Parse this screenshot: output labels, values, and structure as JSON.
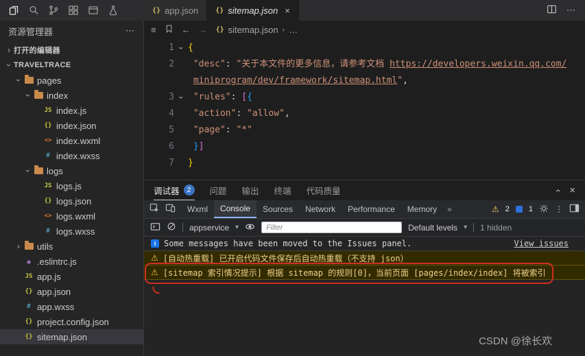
{
  "tabs": {
    "items": [
      {
        "icon": "{}",
        "label": "app.json"
      },
      {
        "icon": "{}",
        "label": "sitemap.json",
        "close": "×"
      }
    ],
    "more": "⋯"
  },
  "sidebar": {
    "title": "资源管理器",
    "more": "⋯",
    "tree": [
      {
        "label": "打开的编辑器",
        "level": 0,
        "chev": "right",
        "icon": "none",
        "section": true
      },
      {
        "label": "TRAVELTRACE",
        "level": 0,
        "chev": "down",
        "icon": "none",
        "section": true
      },
      {
        "label": "pages",
        "level": 1,
        "chev": "down",
        "icon": "folder"
      },
      {
        "label": "index",
        "level": 2,
        "chev": "down",
        "icon": "folder"
      },
      {
        "label": "index.js",
        "level": 3,
        "icon": "js"
      },
      {
        "label": "index.json",
        "level": 3,
        "icon": "json"
      },
      {
        "label": "index.wxml",
        "level": 3,
        "icon": "wxml"
      },
      {
        "label": "index.wxss",
        "level": 3,
        "icon": "wxss"
      },
      {
        "label": "logs",
        "level": 2,
        "chev": "down",
        "icon": "folder"
      },
      {
        "label": "logs.js",
        "level": 3,
        "icon": "js"
      },
      {
        "label": "logs.json",
        "level": 3,
        "icon": "json"
      },
      {
        "label": "logs.wxml",
        "level": 3,
        "icon": "wxml"
      },
      {
        "label": "logs.wxss",
        "level": 3,
        "icon": "wxss"
      },
      {
        "label": "utils",
        "level": 1,
        "chev": "right",
        "icon": "folder"
      },
      {
        "label": ".eslintrc.js",
        "level": 1,
        "icon": "eslint"
      },
      {
        "label": "app.js",
        "level": 1,
        "icon": "js"
      },
      {
        "label": "app.json",
        "level": 1,
        "icon": "json"
      },
      {
        "label": "app.wxss",
        "level": 1,
        "icon": "wxss"
      },
      {
        "label": "project.config.json",
        "level": 1,
        "icon": "json"
      },
      {
        "label": "sitemap.json",
        "level": 1,
        "icon": "json",
        "selected": true
      }
    ]
  },
  "file_icons": {
    "js": "JS",
    "json": "{}",
    "wxml": "<>",
    "wxss": "#",
    "eslint": "◈",
    "folder": ""
  },
  "breadcrumb": {
    "outline_icon": "≡",
    "back": "←",
    "forward": "→",
    "file_icon": "{}",
    "file": "sitemap.json",
    "sep": "›",
    "more": "…"
  },
  "editor": {
    "lines": [
      {
        "num": "1",
        "fold": true,
        "tokens": [
          {
            "c": "b0",
            "t": "{"
          }
        ]
      },
      {
        "num": "2",
        "tokens": [
          {
            "c": "pun",
            "t": " "
          },
          {
            "c": "key",
            "t": "\"desc\""
          },
          {
            "c": "pun",
            "t": ": "
          },
          {
            "c": "str",
            "t": "\"关于本文件的更多信息，请参考文档 "
          },
          {
            "c": "link",
            "t": "https://developers.weixin.qq.com/"
          }
        ]
      },
      {
        "num": "",
        "tokens": [
          {
            "c": "pun",
            "t": " "
          },
          {
            "c": "link",
            "t": "miniprogram/dev/framework/sitemap.html"
          },
          {
            "c": "str",
            "t": "\""
          },
          {
            "c": "pun",
            "t": ","
          }
        ]
      },
      {
        "num": "3",
        "fold": true,
        "tokens": [
          {
            "c": "pun",
            "t": " "
          },
          {
            "c": "key",
            "t": "\"rules\""
          },
          {
            "c": "pun",
            "t": ": "
          },
          {
            "c": "b1",
            "t": "["
          },
          {
            "c": "b2",
            "t": "{"
          }
        ]
      },
      {
        "num": "4",
        "tokens": [
          {
            "c": "pun",
            "t": " "
          },
          {
            "c": "key",
            "t": "\"action\""
          },
          {
            "c": "pun",
            "t": ": "
          },
          {
            "c": "str",
            "t": "\"allow\""
          },
          {
            "c": "pun",
            "t": ","
          }
        ]
      },
      {
        "num": "5",
        "tokens": [
          {
            "c": "pun",
            "t": " "
          },
          {
            "c": "key",
            "t": "\"page\""
          },
          {
            "c": "pun",
            "t": ": "
          },
          {
            "c": "str",
            "t": "\"*\""
          }
        ]
      },
      {
        "num": "6",
        "tokens": [
          {
            "c": "pun",
            "t": " "
          },
          {
            "c": "b2",
            "t": "}"
          },
          {
            "c": "b1",
            "t": "]"
          }
        ]
      },
      {
        "num": "7",
        "tokens": [
          {
            "c": "b0",
            "t": "}"
          }
        ]
      }
    ]
  },
  "panel": {
    "tabs": [
      {
        "label": "调试器",
        "badge": "2",
        "active": true
      },
      {
        "label": "问题"
      },
      {
        "label": "输出"
      },
      {
        "label": "终端"
      },
      {
        "label": "代码质量"
      }
    ],
    "collapse_icon": "›",
    "close_icon": "×"
  },
  "devtools": {
    "tabs": [
      {
        "label": "Wxml"
      },
      {
        "label": "Console",
        "active": true
      },
      {
        "label": "Sources"
      },
      {
        "label": "Network"
      },
      {
        "label": "Performance"
      },
      {
        "label": "Memory"
      }
    ],
    "overflow": "»",
    "warning_count": "2",
    "issue_count": "1"
  },
  "console": {
    "context": "appservice",
    "context_caret": "▾",
    "filter_placeholder": "Filter",
    "levels": "Default levels",
    "levels_caret": "▾",
    "hidden": "1 hidden",
    "messages": [
      {
        "type": "info",
        "text": "Some messages have been moved to the Issues panel.",
        "link": "View issues"
      },
      {
        "type": "warning",
        "icon": "⚠",
        "text": "[自动热重载] 已开启代码文件保存后自动热重载（不支持 json）"
      },
      {
        "type": "warning",
        "icon": "⚠",
        "text": "[sitemap 索引情况提示] 根据 sitemap 的规则[0]，当前页面 [pages/index/index] 将被索引",
        "annotated": true
      }
    ]
  },
  "watermark": "CSDN @徐长欢"
}
